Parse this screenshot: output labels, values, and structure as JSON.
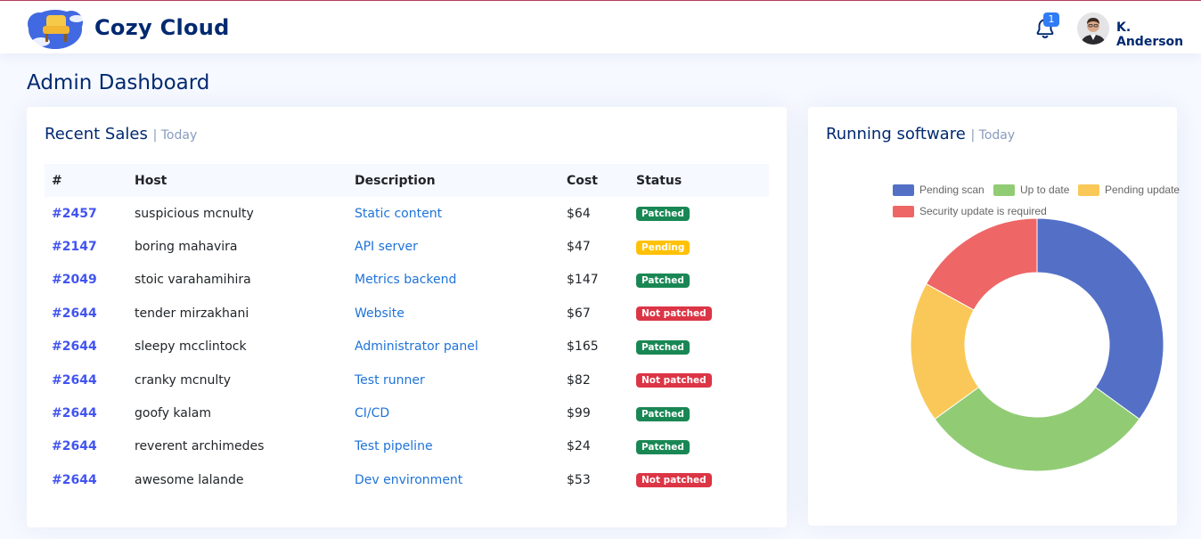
{
  "brand": {
    "name": "Cozy Cloud",
    "logo_icon": "armchair-cloud-logo"
  },
  "header": {
    "notifications_count": "1",
    "user_name": "K. Anderson"
  },
  "page": {
    "title": "Admin Dashboard"
  },
  "recent_sales": {
    "title": "Recent Sales",
    "period": "| Today",
    "columns": [
      "#",
      "Host",
      "Description",
      "Cost",
      "Status"
    ],
    "rows": [
      {
        "id": "#2457",
        "host": "suspicious mcnulty",
        "description": "Static content",
        "cost": "$64",
        "status": "Patched",
        "status_type": "patched"
      },
      {
        "id": "#2147",
        "host": "boring mahavira",
        "description": "API server",
        "cost": "$47",
        "status": "Pending",
        "status_type": "pending"
      },
      {
        "id": "#2049",
        "host": "stoic varahamihira",
        "description": "Metrics backend",
        "cost": "$147",
        "status": "Patched",
        "status_type": "patched"
      },
      {
        "id": "#2644",
        "host": "tender mirzakhani",
        "description": "Website",
        "cost": "$67",
        "status": "Not patched",
        "status_type": "notpatched"
      },
      {
        "id": "#2644",
        "host": "sleepy mcclintock",
        "description": "Administrator panel",
        "cost": "$165",
        "status": "Patched",
        "status_type": "patched"
      },
      {
        "id": "#2644",
        "host": "cranky mcnulty",
        "description": "Test runner",
        "cost": "$82",
        "status": "Not patched",
        "status_type": "notpatched"
      },
      {
        "id": "#2644",
        "host": "goofy kalam",
        "description": "CI/CD",
        "cost": "$99",
        "status": "Patched",
        "status_type": "patched"
      },
      {
        "id": "#2644",
        "host": "reverent archimedes",
        "description": "Test pipeline",
        "cost": "$24",
        "status": "Patched",
        "status_type": "patched"
      },
      {
        "id": "#2644",
        "host": "awesome lalande",
        "description": "Dev environment",
        "cost": "$53",
        "status": "Not patched",
        "status_type": "notpatched"
      }
    ]
  },
  "running_software": {
    "title": "Running software",
    "period": "| Today"
  },
  "chart_data": {
    "type": "pie",
    "variant": "doughnut",
    "legend_position": "top",
    "categories": [
      "Pending scan",
      "Up to date",
      "Pending update",
      "Security update is required"
    ],
    "values": [
      35,
      30,
      18,
      17
    ],
    "colors": [
      "#5470c6",
      "#91cc75",
      "#fac858",
      "#ee6666"
    ]
  }
}
